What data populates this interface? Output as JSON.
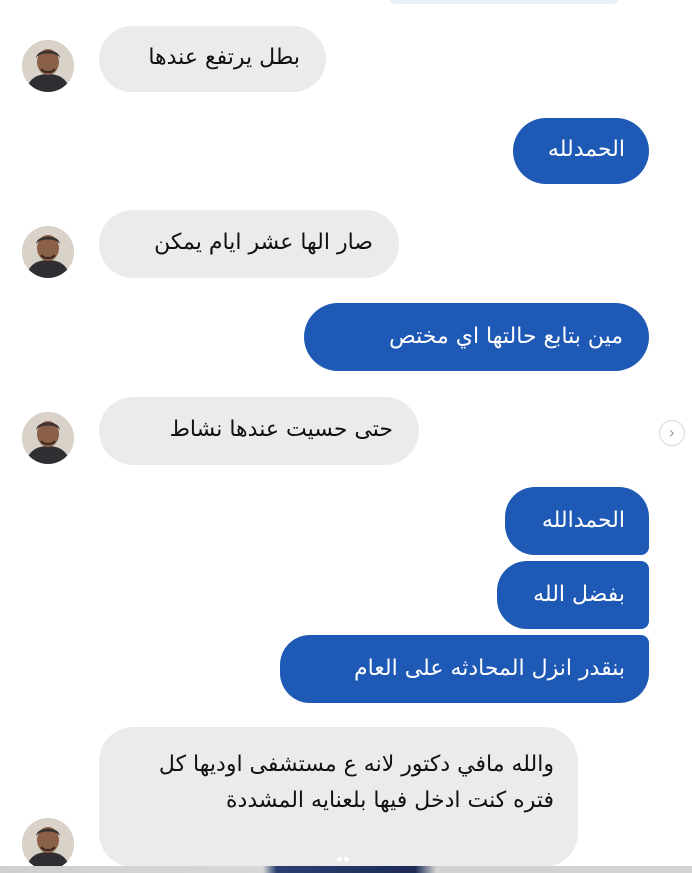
{
  "colors": {
    "incoming_bubble": "#ebebeb",
    "outgoing_bubble": "#1e59b5",
    "incoming_text": "#111111",
    "outgoing_text": "#ffffff",
    "background": "#ffffff"
  },
  "icons": {
    "next": "chevron-right-icon",
    "avatar": "avatar-photo"
  },
  "next_button_glyph": "›",
  "messages": [
    {
      "direction": "incoming",
      "text": "بطل يرتفع عندها"
    },
    {
      "direction": "outgoing",
      "text": "الحمدلله"
    },
    {
      "direction": "incoming",
      "text": "صار الها عشر ايام يمكن"
    },
    {
      "direction": "outgoing",
      "text": "مين بتابع حالتها اي مختص"
    },
    {
      "direction": "incoming",
      "text": "حتى حسيت عندها نشاط"
    },
    {
      "direction": "outgoing",
      "text": "الحمدالله"
    },
    {
      "direction": "outgoing",
      "text": "بفضل الله"
    },
    {
      "direction": "outgoing",
      "text": "بنقدر انزل المحادثه على العام"
    },
    {
      "direction": "incoming",
      "text": "والله مافي دكتور لانه ع مستشفى اوديها كل فتره كنت ادخل فيها بلعنايه المشددة"
    }
  ]
}
